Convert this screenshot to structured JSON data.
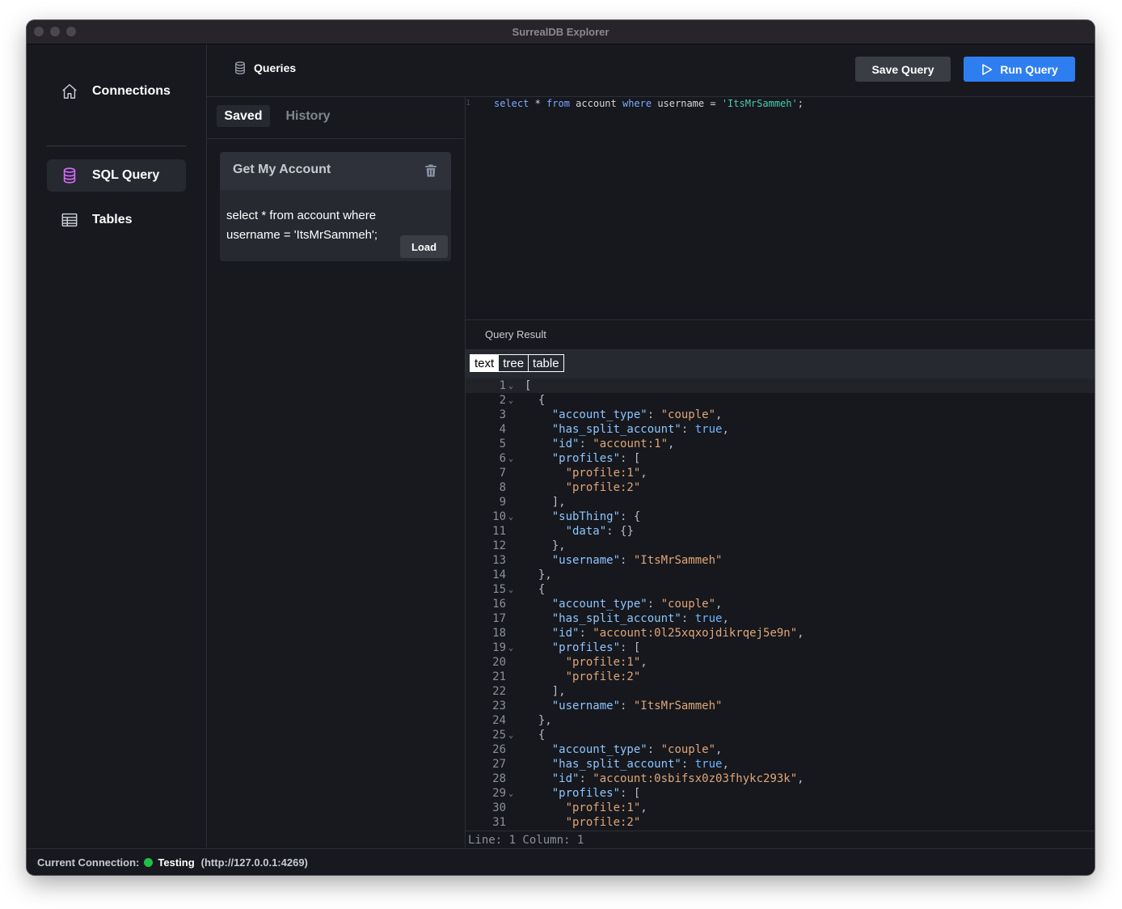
{
  "window": {
    "title": "SurrealDB Explorer"
  },
  "sidebar": {
    "items": [
      {
        "label": "Connections",
        "icon": "home-icon"
      },
      {
        "label": "SQL Query",
        "icon": "database-icon",
        "active": true
      },
      {
        "label": "Tables",
        "icon": "table-icon"
      }
    ]
  },
  "header": {
    "title": "Queries",
    "save_label": "Save Query",
    "run_label": "Run Query"
  },
  "queries": {
    "tabs": [
      {
        "label": "Saved",
        "active": true
      },
      {
        "label": "History",
        "active": false
      }
    ],
    "saved": [
      {
        "name": "Get My Account",
        "sql": "select * from account where username = 'ItsMrSammeh';",
        "load_label": "Load"
      }
    ]
  },
  "editor": {
    "line_number": "1",
    "kw_select": "select",
    "star": " * ",
    "kw_from": "from",
    "table": " account ",
    "kw_where": "where",
    "cond": " username = ",
    "value": "'ItsMrSammeh'",
    "end": ";"
  },
  "result": {
    "title": "Query Result",
    "modes": [
      "text",
      "tree",
      "table"
    ],
    "active_mode": "text",
    "lines": [
      "[",
      "  {",
      "    \"account_type\": \"couple\",",
      "    \"has_split_account\": true,",
      "    \"id\": \"account:1\",",
      "    \"profiles\": [",
      "      \"profile:1\",",
      "      \"profile:2\"",
      "    ],",
      "    \"subThing\": {",
      "      \"data\": {}",
      "    },",
      "    \"username\": \"ItsMrSammeh\"",
      "  },",
      "  {",
      "    \"account_type\": \"couple\",",
      "    \"has_split_account\": true,",
      "    \"id\": \"account:0l25xqxojdikrqej5e9n\",",
      "    \"profiles\": [",
      "      \"profile:1\",",
      "      \"profile:2\"",
      "    ],",
      "    \"username\": \"ItsMrSammeh\"",
      "  },",
      "  {",
      "    \"account_type\": \"couple\",",
      "    \"has_split_account\": true,",
      "    \"id\": \"account:0sbifsx0z03fhykc293k\",",
      "    \"profiles\": [",
      "      \"profile:1\",",
      "      \"profile:2\""
    ],
    "fold_lines": [
      1,
      2,
      6,
      10,
      15,
      19,
      25,
      29
    ],
    "status": "Line: 1  Column: 1"
  },
  "footer": {
    "label": "Current Connection:",
    "name": "Testing",
    "url": "(http://127.0.0.1:4269)",
    "status_color": "#1fbf4a"
  }
}
